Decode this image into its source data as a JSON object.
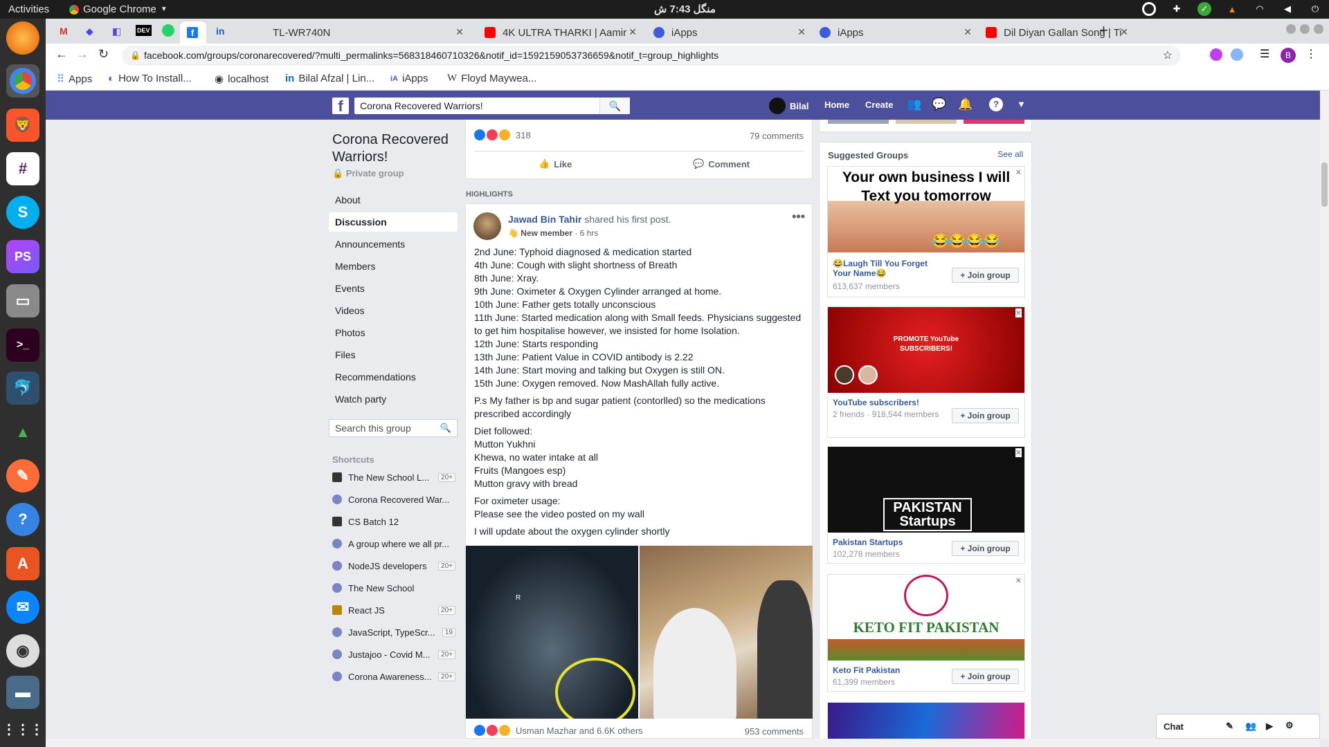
{
  "os": {
    "activities": "Activities",
    "app_name": "Google Chrome",
    "clock": "منگل 7:43 ش"
  },
  "tabs": [
    {
      "label": "TL-WR740N"
    },
    {
      "label": "4K ULTRA THARKI | Aamir"
    },
    {
      "label": "iApps"
    },
    {
      "label": "iApps"
    },
    {
      "label": "Dil Diyan Gallan Song | Ti"
    }
  ],
  "address": {
    "url": "facebook.com/groups/coronarecovered/?multi_permalinks=568318460710326&notif_id=1592159053736659&notif_t=group_highlights"
  },
  "bookmarks": [
    {
      "label": "Apps"
    },
    {
      "label": "How To Install..."
    },
    {
      "label": "localhost"
    },
    {
      "label": "Bilal Afzal | Lin..."
    },
    {
      "label": "iApps"
    },
    {
      "label": "Floyd Maywea..."
    }
  ],
  "fb": {
    "search_value": "Corona Recovered Warriors!",
    "user": "Bilal",
    "home": "Home",
    "create": "Create"
  },
  "group": {
    "name": "Corona Recovered Warriors!",
    "privacy": "Private group",
    "nav": [
      {
        "label": "About"
      },
      {
        "label": "Discussion"
      },
      {
        "label": "Announcements"
      },
      {
        "label": "Members"
      },
      {
        "label": "Events"
      },
      {
        "label": "Videos"
      },
      {
        "label": "Photos"
      },
      {
        "label": "Files"
      },
      {
        "label": "Recommendations"
      },
      {
        "label": "Watch party"
      }
    ],
    "search_placeholder": "Search this group",
    "shortcuts_title": "Shortcuts",
    "shortcuts": [
      {
        "label": "The New School L...",
        "count": "20+"
      },
      {
        "label": "Corona Recovered War...",
        "count": ""
      },
      {
        "label": "CS Batch 12",
        "count": ""
      },
      {
        "label": "A group where we all pr...",
        "count": ""
      },
      {
        "label": "NodeJS developers",
        "count": "20+"
      },
      {
        "label": "The New School",
        "count": ""
      },
      {
        "label": "React JS",
        "count": "20+"
      },
      {
        "label": "JavaScript, TypeScr...",
        "count": "19"
      },
      {
        "label": "Justajoo - Covid M...",
        "count": "20+"
      },
      {
        "label": "Corona Awareness...",
        "count": "20+"
      }
    ]
  },
  "prev_post": {
    "reactions": "318",
    "comments": "79 comments",
    "like": "Like",
    "comment": "Comment"
  },
  "highlights_label": "HIGHLIGHTS",
  "post": {
    "author": "Jawad Bin Tahir",
    "action": "shared his first post.",
    "badge": "New member",
    "time": "· 6 hrs",
    "lines1": [
      "2nd June: Typhoid diagnosed & medication started",
      "4th June: Cough with slight shortness of Breath",
      "8th June: Xray.",
      "9th June: Oximeter & Oxygen Cylinder arranged at home.",
      "10th June: Father gets totally unconscious",
      "11th June: Started medication along with Small feeds. Physicians suggested to get him hospitalise however, we insisted for home Isolation.",
      "12th June: Starts responding",
      "13th June: Patient Value in COVID antibody is 2.22",
      "14th June: Start moving and talking but Oxygen is still ON.",
      "15th June: Oxygen removed. Now MashAllah fully active."
    ],
    "ps": "P.s My father is bp and sugar patient (contorlled) so the medications prescribed accordingly",
    "diet": [
      "Diet followed:",
      "Mutton Yukhni",
      "Khewa, no water intake at all",
      "Fruits (Mangoes esp)",
      "Mutton gravy with bread"
    ],
    "oxi": [
      "For oximeter usage:",
      "Please see the video posted on my wall"
    ],
    "update": "I will update about the oxygen cylinder shortly",
    "reactors": "Usman Mazhar and 6.6K others",
    "comments": "953 comments"
  },
  "suggested": {
    "title": "Suggested Groups",
    "see_all": "See all",
    "join": "Join group",
    "groups": [
      {
        "image_text": "Your own business I will Text you tomorrow",
        "name": "😂Laugh Till You Forget Your Name😂",
        "members": "613,637 members"
      },
      {
        "image_text": "PROMOTE YouTube SUBSCRIBERS!",
        "name": "YouTube subscribers!",
        "members": "2 friends · 918,544 members"
      },
      {
        "image_text": "PAKISTAN Startups",
        "name": "Pakistan Startups",
        "members": "102,278 members"
      },
      {
        "image_text": "KETO FIT PAKISTAN",
        "name": "Keto Fit Pakistan",
        "members": "61,399 members"
      }
    ]
  },
  "chat": {
    "label": "Chat"
  }
}
